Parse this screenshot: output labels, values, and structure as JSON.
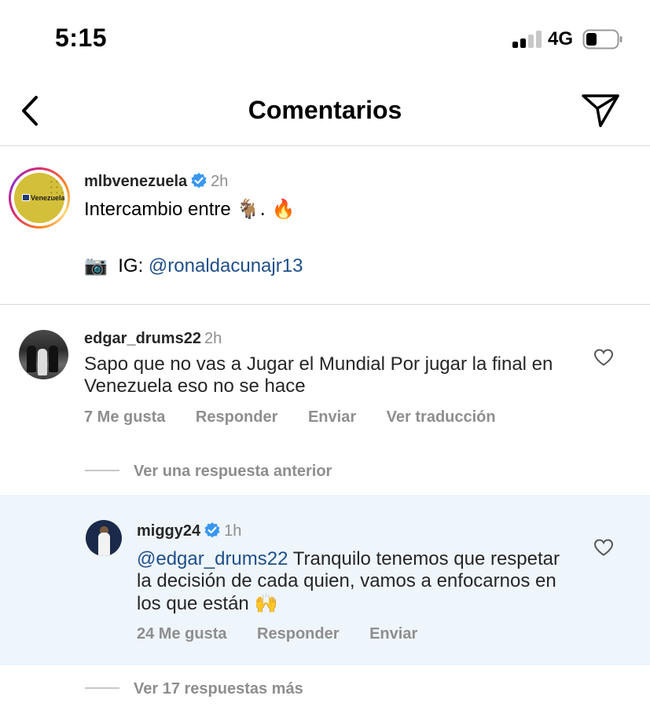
{
  "status_bar": {
    "time": "5:15",
    "network": "4G",
    "signal_bars_active": 2,
    "signal_bars_total": 4
  },
  "header": {
    "title": "Comentarios"
  },
  "caption": {
    "username": "mlbvenezuela",
    "time": "2h",
    "logo_text": "Venezuela",
    "text_line1": "Intercambio entre",
    "text_line1_emojis": "🐐. 🔥",
    "text_line2_emoji": "📷",
    "text_line2_prefix": "IG:",
    "text_line2_mention": "@ronaldacunajr13"
  },
  "comments": [
    {
      "username": "edgar_drums22",
      "time": "2h",
      "text": "Sapo que no vas a Jugar el Mundial Por jugar la final en Venezuela eso no se hace",
      "likes": "7 Me gusta",
      "reply": "Responder",
      "send": "Enviar",
      "translate": "Ver traducción",
      "view_previous": "Ver una respuesta anterior"
    }
  ],
  "reply": {
    "username": "miggy24",
    "time": "1h",
    "mention": "@edgar_drums22",
    "text": " Tranquilo tenemos que respetar la decisión de cada quien, vamos a enfocarnos en los que están ",
    "emoji": "🙌",
    "likes": "24 Me gusta",
    "reply": "Responder",
    "send": "Enviar"
  },
  "view_more": "Ver 17 respuestas más",
  "colors": {
    "verified": "#3897f0",
    "mention": "#1f4f8a",
    "secondary": "#8e8e8e",
    "reply_bg": "#eef5fb"
  }
}
